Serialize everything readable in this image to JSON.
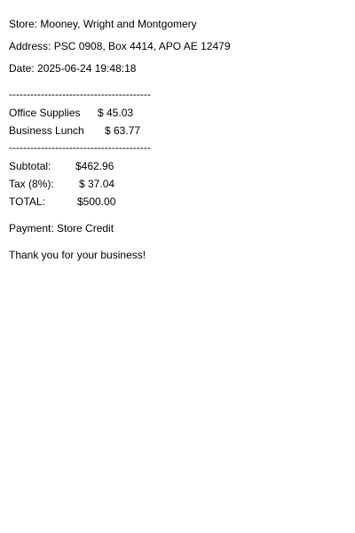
{
  "receipt": {
    "store": "Store: Mooney, Wright and Montgomery",
    "address": "Address: PSC 0908, Box 4414, APO AE 12479",
    "date": "Date: 2025-06-24 19:48:18",
    "divider": "----------------------------------------",
    "items": [
      {
        "name": "Office Supplies",
        "price": "$ 45.03"
      },
      {
        "name": "Business Lunch",
        "price": "$ 63.77"
      }
    ],
    "totals": {
      "subtotal_label": "Subtotal:",
      "subtotal_value": "$462.96",
      "tax_label": "Tax (8%):",
      "tax_value": "$ 37.04",
      "total_label": "TOTAL:",
      "total_value": "$500.00"
    },
    "payment": "Payment: Store Credit",
    "thanks": "Thank you for your business!"
  }
}
